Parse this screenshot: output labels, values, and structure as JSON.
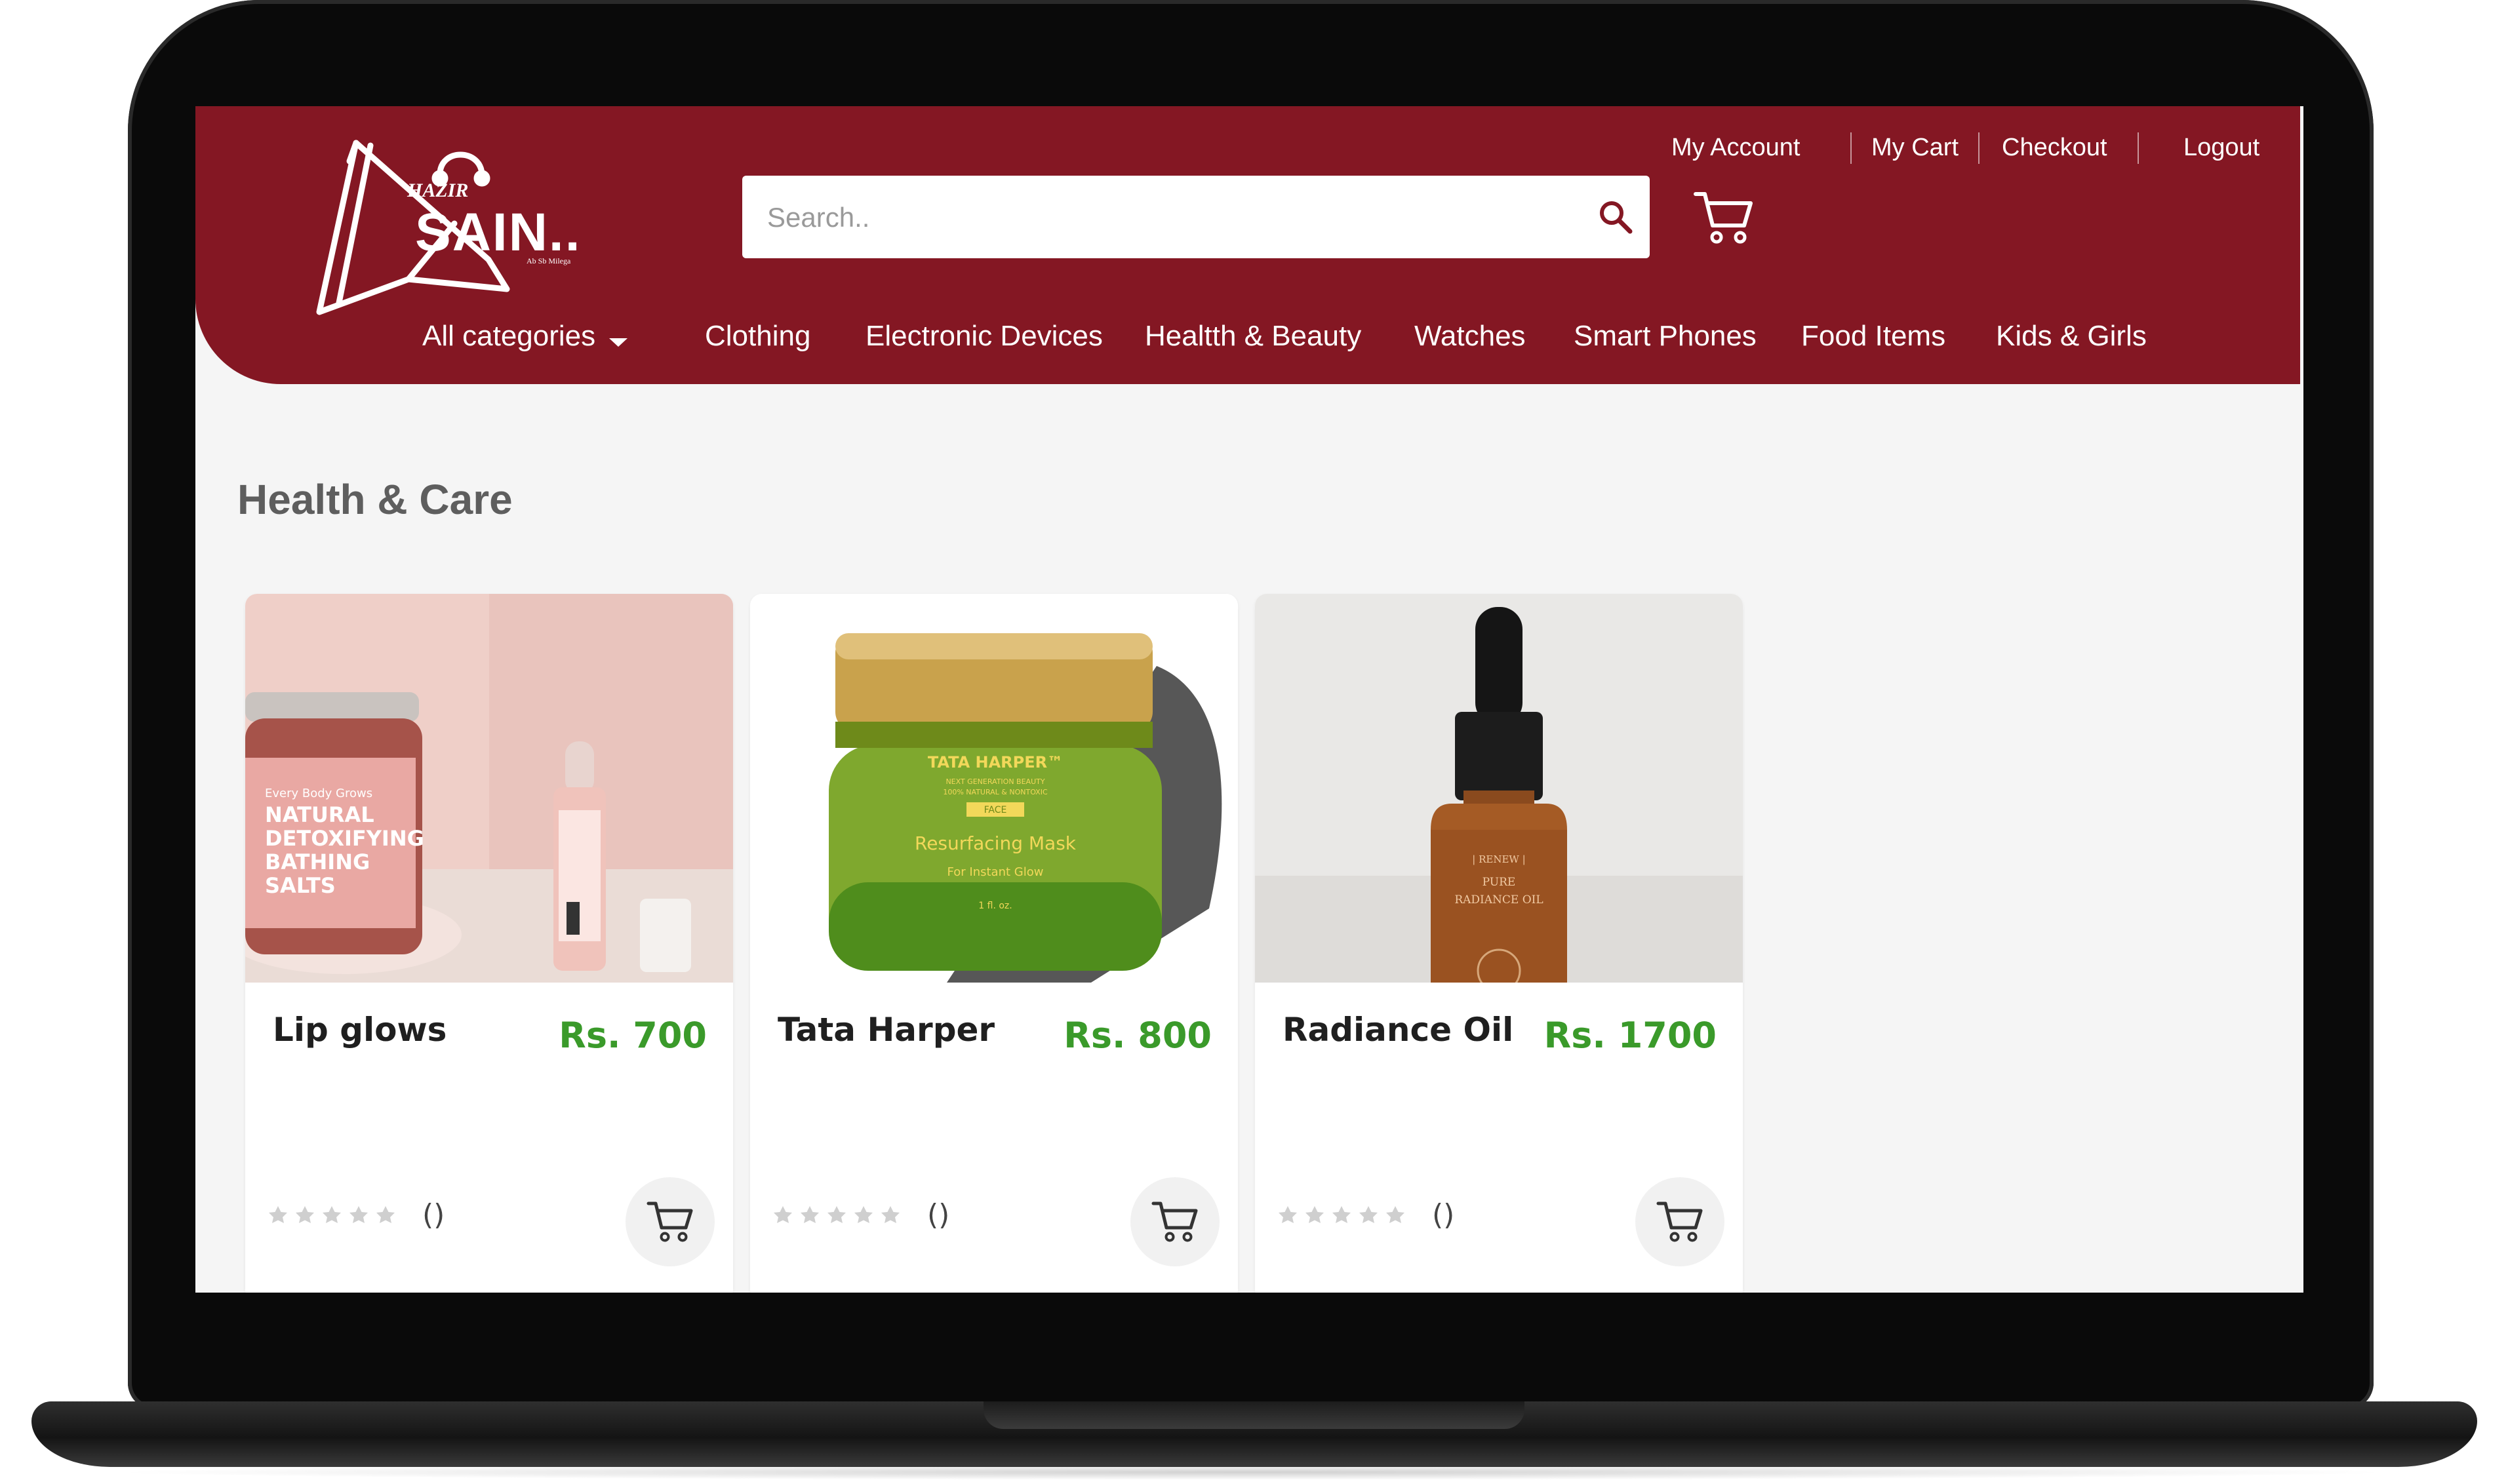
{
  "brand": {
    "name": "Hazir Sain",
    "logo_small": "HAZIR",
    "logo_big": "SAIN..",
    "logo_tag": "Ab Sb Milega"
  },
  "top_links": {
    "my_account": "My Account",
    "my_cart": "My Cart",
    "checkout": "Checkout",
    "logout": "Logout"
  },
  "search": {
    "placeholder": "Search..",
    "icon": "search-icon"
  },
  "header_cart_icon": "cart-icon",
  "nav": {
    "all_categories": "All categories",
    "items": [
      "Clothing",
      "Electronic Devices",
      "Healtth & Beauty",
      "Watches",
      "Smart Phones",
      "Food Items",
      "Kids & Girls"
    ]
  },
  "section": {
    "title": "Health & Care"
  },
  "products": [
    {
      "name": "Lip glows",
      "price": "Rs. 700",
      "rating_count": "()",
      "image_text": [
        "Every Body Grows",
        "NATURAL",
        "DETOXIFYING",
        "BATHING",
        "SALTS"
      ]
    },
    {
      "name": "Tata Harper",
      "price": "Rs. 800",
      "rating_count": "()",
      "image_text": [
        "TATA HARPER™",
        "NEXT GENERATION BEAUTY",
        "100% NATURAL & NONTOXIC",
        "FACE",
        "Resurfacing Mask",
        "For Instant Glow",
        "1 fl. oz."
      ]
    },
    {
      "name": "Radiance Oil",
      "price": "Rs. 1700",
      "rating_count": "()",
      "image_text": [
        "| RENEW |",
        "PURE",
        "RADIANCE OIL"
      ]
    }
  ],
  "colors": {
    "header": "#841723",
    "price": "#3a9a2a",
    "page_bg": "#f5f5f5"
  }
}
